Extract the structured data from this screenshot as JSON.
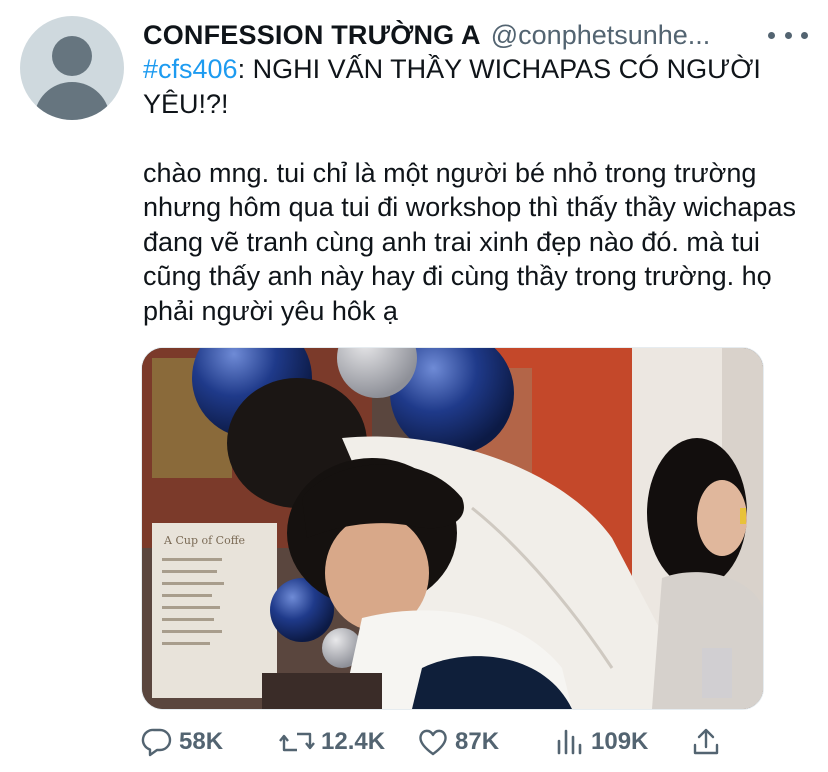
{
  "account": {
    "display_name": "CONFESSION TRƯỜNG A",
    "handle": "@conphetsunhe..."
  },
  "tweet": {
    "hashtag": "#cfs406",
    "title_rest": ": NGHI VẤN THẦY WICHAPAS CÓ NGƯỜI YÊU!?!",
    "body": "chào mng. tui chỉ là một người bé nhỏ trong trường nhưng hôm qua tui đi workshop thì thấy thầy wichapas đang vẽ tranh cùng anh trai xinh đẹp nào đó. mà tui cũng thấy anh này hay đi cùng thầy trong trường. họ phải người yêu hôk ạ"
  },
  "media": {
    "poster_text": "A Cup of Coffe"
  },
  "actions": {
    "replies": "58K",
    "retweets": "12.4K",
    "likes": "87K",
    "views": "109K"
  },
  "colors": {
    "accent": "#1d9bf0",
    "secondary_text": "#536471"
  }
}
